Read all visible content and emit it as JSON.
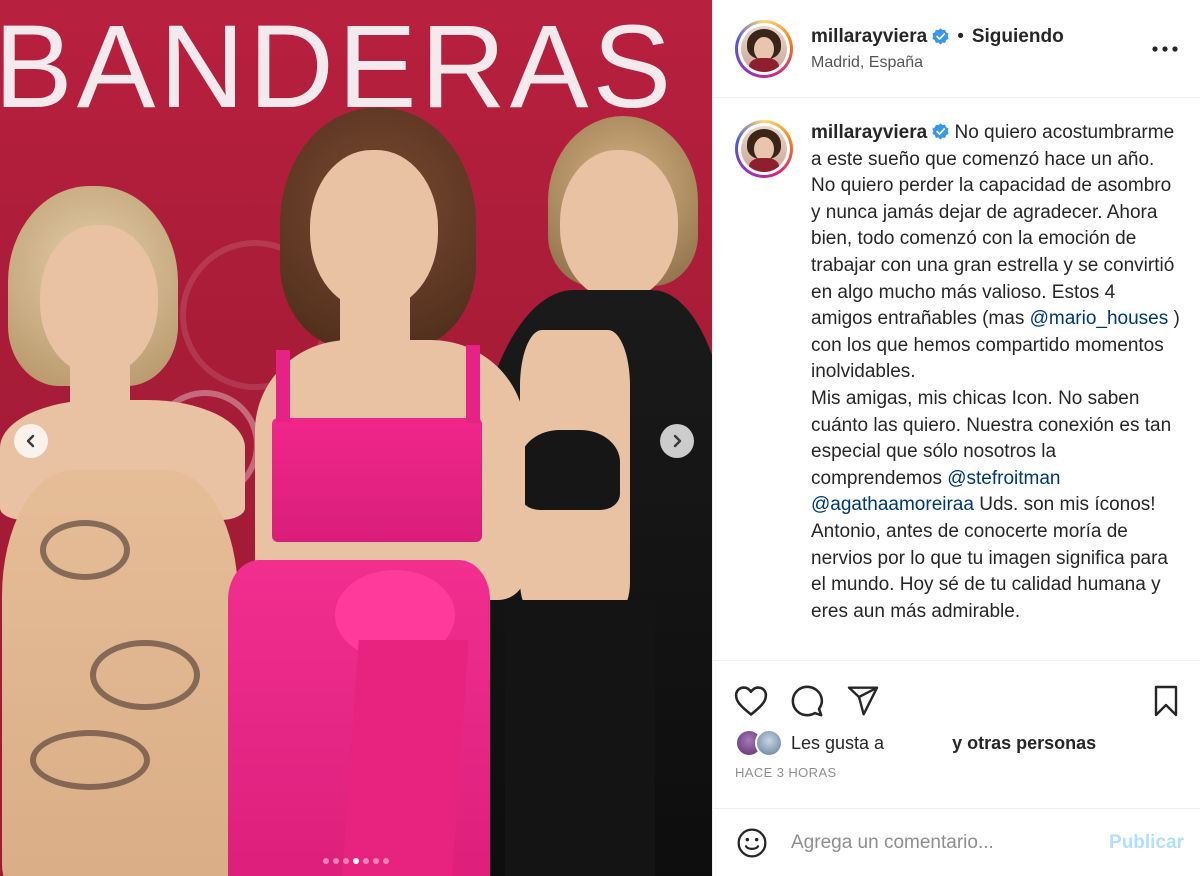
{
  "post": {
    "username": "millarayviera",
    "follow_state": "Siguiendo",
    "separator": "•",
    "location": "Madrid, España",
    "backdrop_text": "BANDERAS",
    "carousel": {
      "dot_count": 7,
      "active_index": 3
    }
  },
  "caption": {
    "username": "millarayviera",
    "part1": " No quiero acostumbrarme a este sueño que comenzó hace un año. No quiero perder la capacidad de asombro y nunca jamás dejar de agradecer. Ahora bien, todo comenzó con la emoción de trabajar con una gran estrella y se convirtió en algo mucho más valioso. Estos 4 amigos entrañables (mas ",
    "mention1": "@mario_houses",
    "part2": " ) con los que hemos compartido momentos inolvidables.",
    "part3": "Mis amigas, mis chicas Icon. No saben cuánto las quiero. Nuestra conexión es tan especial que sólo nosotros la comprendemos ",
    "mention2": "@stefroitman",
    "mention3": "@agathaamoreiraa",
    "part4": " Uds. son mis íconos! Antonio, antes de conocerte moría de nervios por lo que tu imagen significa para el mundo. Hoy sé de tu calidad humana y eres aun más admirable."
  },
  "likes": {
    "prefix": "Les gusta a",
    "suffix": "y otras personas"
  },
  "time_ago": "HACE 3 HORAS",
  "comment": {
    "placeholder": "Agrega un comentario...",
    "publish_label": "Publicar"
  },
  "colors": {
    "verified": "#3897f0",
    "mention": "#00376b",
    "publish_disabled": "#b2dffc"
  },
  "icons": {
    "verified": "verified-badge-icon",
    "more": "more-options-icon",
    "prev": "chevron-left-icon",
    "next": "chevron-right-icon",
    "like": "heart-icon",
    "comment": "comment-icon",
    "share": "paper-plane-icon",
    "save": "bookmark-icon",
    "emoji": "emoji-icon"
  }
}
